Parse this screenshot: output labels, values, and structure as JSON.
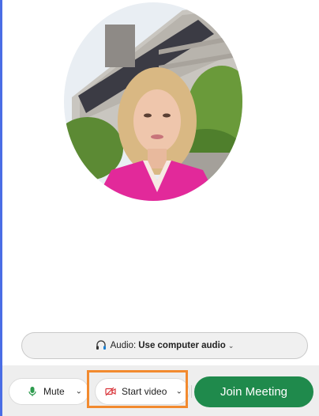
{
  "audio": {
    "label": "Audio:",
    "value": "Use computer audio",
    "icon": "headset-icon"
  },
  "toolbar": {
    "mute_label": "Mute",
    "start_video_label": "Start video",
    "join_label": "Join Meeting"
  },
  "colors": {
    "join_green": "#1f8a4c",
    "highlight_orange": "#f28a2f",
    "video_off_red": "#d9343a",
    "mic_green": "#2e9b4e",
    "frame_blue": "#4a6de5"
  }
}
